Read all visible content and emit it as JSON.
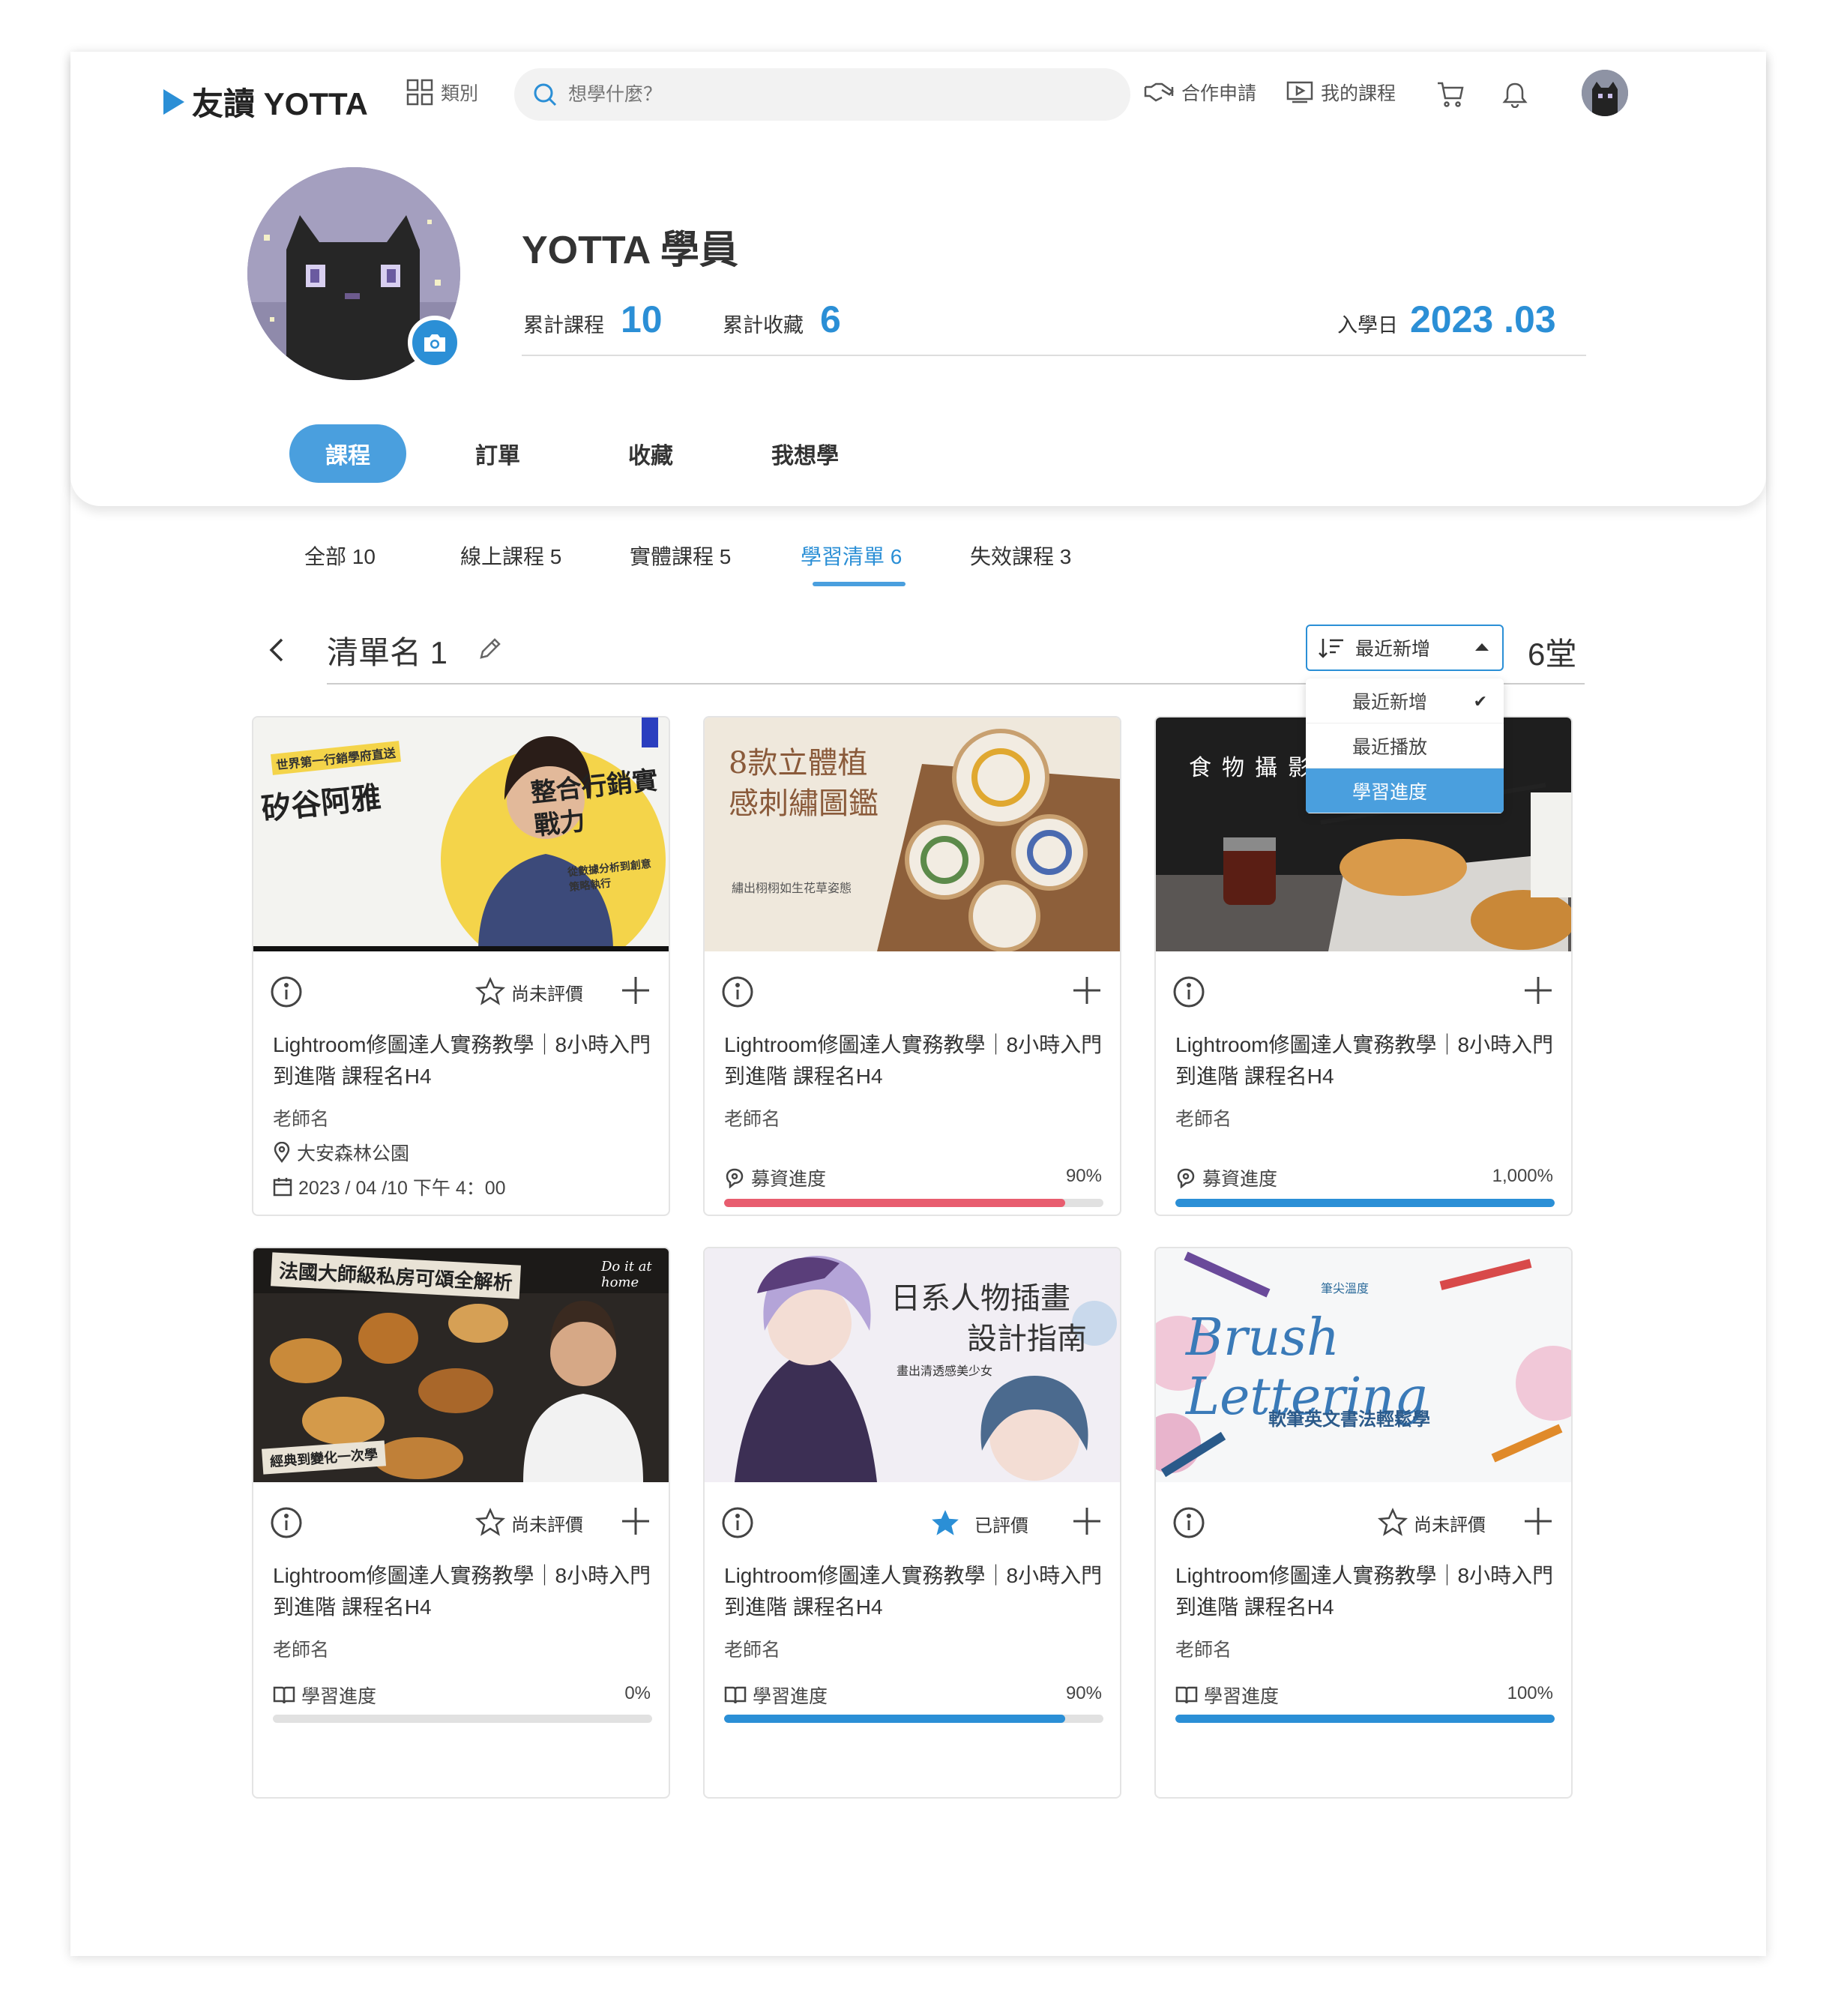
{
  "nav": {
    "logo_text": "友讀 YOTTA",
    "category": "類別",
    "search_placeholder": "想學什麼？",
    "partner": "合作申請",
    "my_courses": "我的課程"
  },
  "profile": {
    "name": "YOTTA 學員",
    "total_courses_label": "累計課程",
    "total_courses": "10",
    "total_saved_label": "累計收藏",
    "total_saved": "6",
    "enroll_label": "入學日",
    "enroll_date": "2023 .03"
  },
  "profile_tabs": [
    "課程",
    "訂單",
    "收藏",
    "我想學"
  ],
  "sub_tabs": [
    "全部 10",
    "線上課程 5",
    "實體課程 5",
    "學習清單 6",
    "失效課程 3"
  ],
  "list": {
    "name": "清單名 1",
    "sort_selected": "最近新增",
    "count": "6堂",
    "sort_options": [
      "最近新增",
      "最近播放",
      "學習進度"
    ],
    "sort_checked": "最近新增",
    "sort_highlighted": "學習進度"
  },
  "colors": {
    "accent": "#2b8fd6",
    "fundraise_red": "#e85d6f",
    "bar_bg": "#e1e1e1"
  },
  "cards": [
    {
      "title": "Lightroom修圖達人實務教學｜8小時入門到進階 課程名H4",
      "teacher": "老師名",
      "rating": "尚未評價",
      "location": "大安森林公園",
      "datetime": "2023 / 04 /10 下午 4：00",
      "thumb": {
        "headline": "矽谷阿雅",
        "tag": "世界第一行銷學府直送",
        "sub": "整合行銷實戰力",
        "note": "從數據分析到創意策略執行"
      }
    },
    {
      "title": "Lightroom修圖達人實務教學｜8小時入門到進階 課程名H4",
      "teacher": "老師名",
      "progress_label": "募資進度",
      "progress_value": "90%",
      "progress": 0.9,
      "thumb": {
        "headline": "8款立體植感刺繡圖鑑",
        "sub": "繡出栩栩如生花草姿態"
      }
    },
    {
      "title": "Lightroom修圖達人實務教學｜8小時入門到進階 課程名H4",
      "teacher": "老師名",
      "progress_label": "募資進度",
      "progress_value": "1,000%",
      "progress": 1.0,
      "thumb": {
        "headline": "食物攝影"
      }
    },
    {
      "title": "Lightroom修圖達人實務教學｜8小時入門到進階 課程名H4",
      "teacher": "老師名",
      "rating": "尚未評價",
      "progress_label": "學習進度",
      "progress_value": "0%",
      "progress": 0,
      "thumb": {
        "headline": "法國大師級私房可頌全解析",
        "sub": "經典到變化一次學",
        "note": "Do it at home"
      }
    },
    {
      "title": "Lightroom修圖達人實務教學｜8小時入門到進階 課程名H4",
      "teacher": "老師名",
      "rating": "已評價",
      "progress_label": "學習進度",
      "progress_value": "90%",
      "progress": 0.9,
      "thumb": {
        "headline": "日系人物插畫",
        "sub": "設計指南",
        "note": "畫出清透感美少女"
      }
    },
    {
      "title": "Lightroom修圖達人實務教學｜8小時入門到進階 課程名H4",
      "teacher": "老師名",
      "rating": "尚未評價",
      "progress_label": "學習進度",
      "progress_value": "100%",
      "progress": 1.0,
      "thumb": {
        "headline": "Brush Lettering",
        "sub": "軟筆英文書法輕鬆學",
        "note": "筆尖溫度"
      }
    }
  ]
}
